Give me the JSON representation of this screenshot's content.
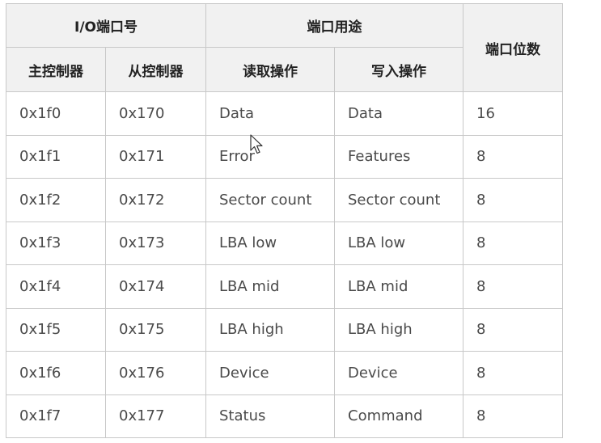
{
  "table": {
    "header": {
      "io_port_group": "I/O端口号",
      "port_usage_group": "端口用途",
      "port_bits": "端口位数",
      "master": "主控制器",
      "slave": "从控制器",
      "read_op": "读取操作",
      "write_op": "写入操作"
    },
    "rows": [
      {
        "master": "0x1f0",
        "slave": "0x170",
        "read": "Data",
        "write": "Data",
        "bits": "16"
      },
      {
        "master": "0x1f1",
        "slave": "0x171",
        "read": "Error",
        "write": "Features",
        "bits": "8"
      },
      {
        "master": "0x1f2",
        "slave": "0x172",
        "read": "Sector count",
        "write": "Sector count",
        "bits": "8"
      },
      {
        "master": "0x1f3",
        "slave": "0x173",
        "read": "LBA low",
        "write": "LBA low",
        "bits": "8"
      },
      {
        "master": "0x1f4",
        "slave": "0x174",
        "read": "LBA mid",
        "write": "LBA mid",
        "bits": "8"
      },
      {
        "master": "0x1f5",
        "slave": "0x175",
        "read": "LBA high",
        "write": "LBA high",
        "bits": "8"
      },
      {
        "master": "0x1f6",
        "slave": "0x176",
        "read": "Device",
        "write": "Device",
        "bits": "8"
      },
      {
        "master": "0x1f7",
        "slave": "0x177",
        "read": "Status",
        "write": "Command",
        "bits": "8"
      }
    ]
  },
  "cursor": {
    "icon": "mouse-pointer-icon"
  }
}
